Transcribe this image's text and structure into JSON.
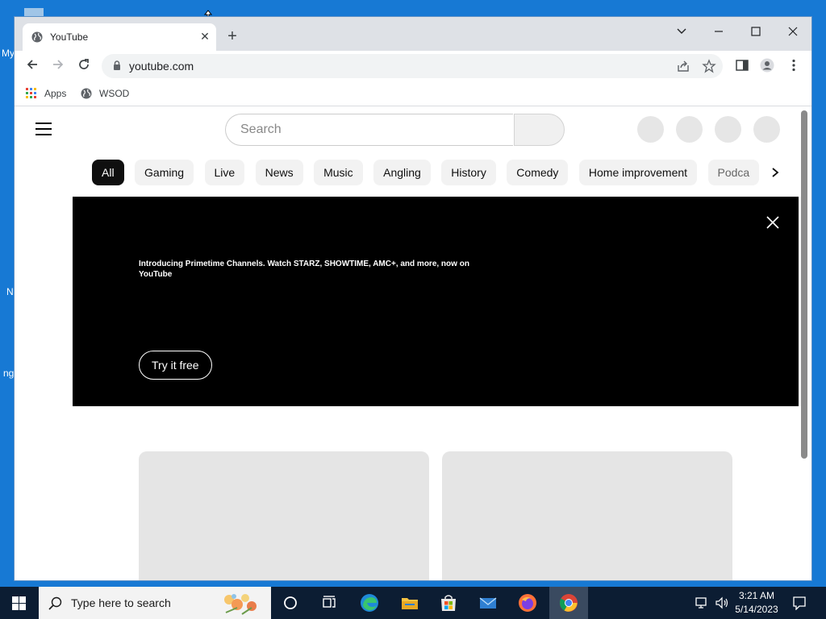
{
  "browser": {
    "tab_title": "YouTube",
    "url": "youtube.com",
    "bookmarks": [
      {
        "label": "Apps",
        "icon": "apps-grid-icon"
      },
      {
        "label": "WSOD",
        "icon": "globe-icon"
      }
    ]
  },
  "youtube": {
    "search_placeholder": "Search",
    "chips": [
      "All",
      "Gaming",
      "Live",
      "News",
      "Music",
      "Angling",
      "History",
      "Comedy",
      "Home improvement",
      "Podca"
    ],
    "active_chip": "All",
    "banner": {
      "text": "Introducing Primetime Channels. Watch STARZ, SHOWTIME, AMC+, and more, now on YouTube",
      "button_label": "Try it free"
    }
  },
  "taskbar": {
    "search_placeholder": "Type here to search",
    "time": "3:21 AM",
    "date": "5/14/2023"
  },
  "desktop": {
    "fragments": [
      "My",
      "N",
      "ng"
    ]
  },
  "colors": {
    "desktop_bg": "#1779d4",
    "chip_active_bg": "#0f0f0f",
    "banner_bg": "#000000",
    "taskbar_bg": "#0c1d33"
  }
}
